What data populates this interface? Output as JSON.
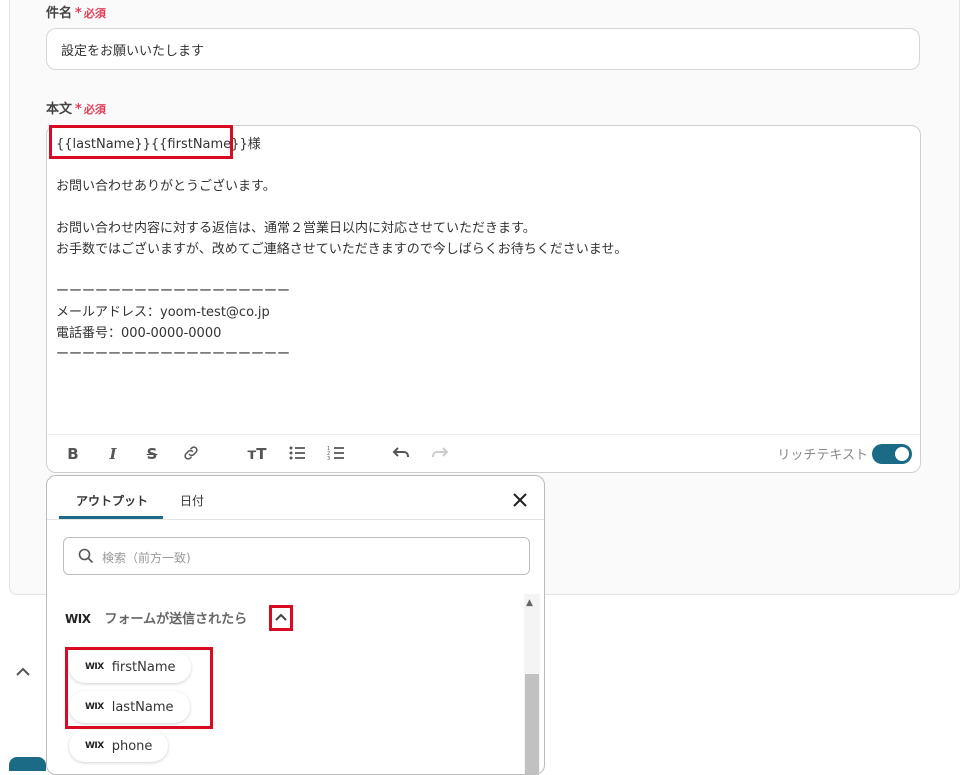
{
  "subject": {
    "label": "件名",
    "required_mark": "*",
    "required_text": "必須",
    "value": "設定をお願いいたします"
  },
  "body": {
    "label": "本文",
    "required_mark": "*",
    "required_text": "必須",
    "lines": [
      "{{lastName}}{{firstName}}様",
      "",
      "お問い合わせありがとうございます。",
      "",
      "お問い合わせ内容に対する返信は、通常２営業日以内に対応させていただきます。",
      "お手数ではございますが、改めてご連絡させていただきますので今しばらくお待ちくださいませ。",
      "",
      "ーーーーーーーーーーーーーーーーーー",
      "メールアドレス：yoom-test@co.jp",
      "電話番号：000-0000-0000",
      "ーーーーーーーーーーーーーーーーーー"
    ],
    "rich_text_label": "リッチテキスト",
    "rich_text_enabled": true
  },
  "toolbar_icons": [
    "bold-icon",
    "italic-icon",
    "strikethrough-icon",
    "link-icon",
    "text-size-icon",
    "bullet-list-icon",
    "numbered-list-icon",
    "undo-icon",
    "redo-icon"
  ],
  "popup": {
    "tabs": [
      {
        "label": "アウトプット",
        "active": true
      },
      {
        "label": "日付",
        "active": false
      }
    ],
    "search_placeholder": "検索（前方一致)",
    "group": {
      "logo": "WIX",
      "title": "フォームが送信されたら"
    },
    "items": [
      {
        "logo": "WIX",
        "label": "firstName"
      },
      {
        "logo": "WIX",
        "label": "lastName"
      },
      {
        "logo": "WIX",
        "label": "phone"
      }
    ]
  },
  "colors": {
    "accent": "#1b6b86",
    "required": "#e0415a",
    "highlight": "#d90b22"
  }
}
